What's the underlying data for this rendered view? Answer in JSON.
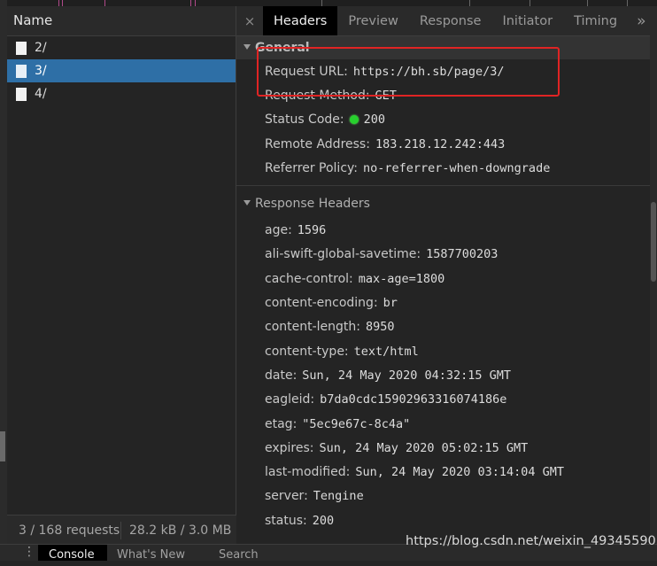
{
  "network": {
    "name_header": "Name",
    "requests": [
      {
        "name": "2/"
      },
      {
        "name": "3/"
      },
      {
        "name": "4/"
      }
    ],
    "status": {
      "requests": "3 / 168 requests",
      "transferred": "28.2 kB / 3.0 MB"
    }
  },
  "tabs": {
    "close": "×",
    "items": [
      "Headers",
      "Preview",
      "Response",
      "Initiator",
      "Timing"
    ],
    "more": "»"
  },
  "general": {
    "title": "General",
    "rows": [
      {
        "key": "Request URL:",
        "value": "https://bh.sb/page/3/"
      },
      {
        "key": "Request Method:",
        "value": "GET"
      },
      {
        "key": "Status Code:",
        "value": "200"
      },
      {
        "key": "Remote Address:",
        "value": "183.218.12.242:443"
      },
      {
        "key": "Referrer Policy:",
        "value": "no-referrer-when-downgrade"
      }
    ]
  },
  "response_headers": {
    "title": "Response Headers",
    "rows": [
      {
        "key": "age:",
        "value": "1596"
      },
      {
        "key": "ali-swift-global-savetime:",
        "value": "1587700203"
      },
      {
        "key": "cache-control:",
        "value": "max-age=1800"
      },
      {
        "key": "content-encoding:",
        "value": "br"
      },
      {
        "key": "content-length:",
        "value": "8950"
      },
      {
        "key": "content-type:",
        "value": "text/html"
      },
      {
        "key": "date:",
        "value": "Sun, 24 May 2020 04:32:15 GMT"
      },
      {
        "key": "eagleid:",
        "value": "b7da0cdc15902963316074186e"
      },
      {
        "key": "etag:",
        "value": "\"5ec9e67c-8c4a\""
      },
      {
        "key": "expires:",
        "value": "Sun, 24 May 2020 05:02:15 GMT"
      },
      {
        "key": "last-modified:",
        "value": "Sun, 24 May 2020 03:14:04 GMT"
      },
      {
        "key": "server:",
        "value": "Tengine"
      },
      {
        "key": "status:",
        "value": "200"
      }
    ]
  },
  "drawer": {
    "tabs": [
      "Console",
      "What's New",
      "Search"
    ]
  },
  "watermark": "https://blog.csdn.net/weixin_49345590",
  "colors": {
    "selected_row": "#2e6fa6",
    "status_ok": "#27d02d",
    "highlight": "#e02424"
  }
}
